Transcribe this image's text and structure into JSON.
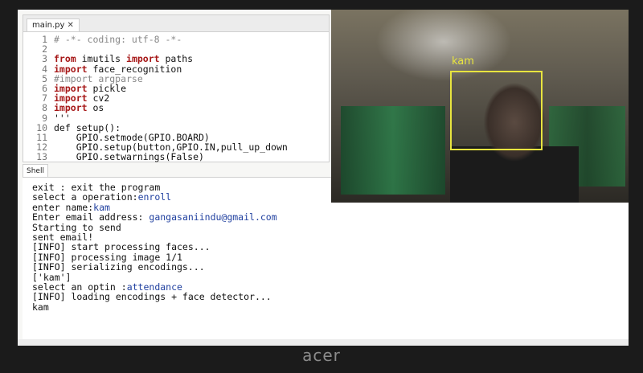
{
  "editor": {
    "tab_label": "main.py",
    "close_glyph": "✕",
    "lines": [
      {
        "n": "1",
        "text": "# -*- coding: utf-8 -*-",
        "style": "cm"
      },
      {
        "n": "2",
        "text": "",
        "style": "src"
      },
      {
        "n": "3",
        "text": "from imutils import paths",
        "style": "mix1"
      },
      {
        "n": "4",
        "text": "import face_recognition",
        "style": "mix2"
      },
      {
        "n": "5",
        "text": "#import argparse",
        "style": "cm"
      },
      {
        "n": "6",
        "text": "import pickle",
        "style": "mix2"
      },
      {
        "n": "7",
        "text": "import cv2",
        "style": "mix2"
      },
      {
        "n": "8",
        "text": "import os",
        "style": "mix2"
      },
      {
        "n": "9",
        "text": "'''",
        "style": "src"
      },
      {
        "n": "10",
        "text": "def setup():",
        "style": "src"
      },
      {
        "n": "11",
        "text": "    GPIO.setmode(GPIO.BOARD)",
        "style": "src"
      },
      {
        "n": "12",
        "text": "    GPIO.setup(button,GPIO.IN,pull_up_down",
        "style": "src"
      },
      {
        "n": "13",
        "text": "    GPIO.setwarnings(False)",
        "style": "src"
      }
    ]
  },
  "shell": {
    "tab_label": "Shell",
    "lines": [
      {
        "prefix": "exit : exit the program",
        "input": ""
      },
      {
        "prefix": "select a operation:",
        "input": "enroll"
      },
      {
        "prefix": "enter name:",
        "input": "kam"
      },
      {
        "prefix": "Enter email address: ",
        "input": "gangasaniindu@gmail.com"
      },
      {
        "prefix": "Starting to send",
        "input": ""
      },
      {
        "prefix": "sent email!",
        "input": ""
      },
      {
        "prefix": "[INFO] start processing faces...",
        "input": ""
      },
      {
        "prefix": "[INFO] processing image 1/1",
        "input": ""
      },
      {
        "prefix": "[INFO] serializing encodings...",
        "input": ""
      },
      {
        "prefix": "['kam']",
        "input": ""
      },
      {
        "prefix": "select an optin :",
        "input": "attendance"
      },
      {
        "prefix": "[INFO] loading encodings + face detector...",
        "input": ""
      },
      {
        "prefix": "kam",
        "input": ""
      }
    ]
  },
  "camera": {
    "face_label": "kam"
  },
  "brand": {
    "logo_text": "acer"
  }
}
